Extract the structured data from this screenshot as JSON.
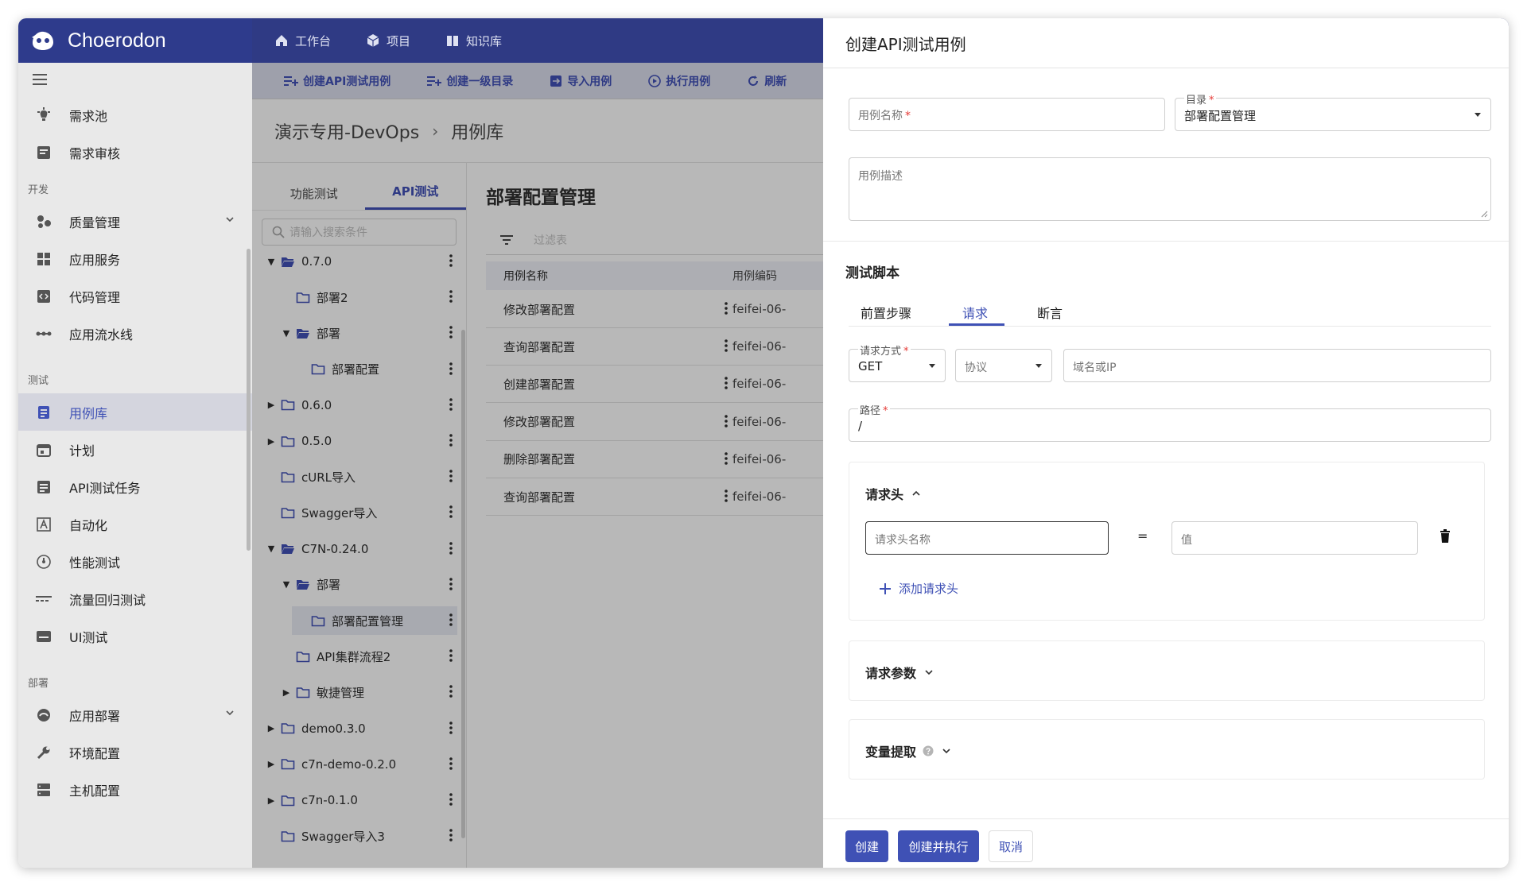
{
  "brand": {
    "name": "Choerodon"
  },
  "sidebar": {
    "items_top": [
      {
        "label": "需求池",
        "icon": "bulb-icon"
      },
      {
        "label": "需求审核",
        "icon": "review-icon"
      }
    ],
    "groups": [
      {
        "title": "开发",
        "items": [
          {
            "label": "质量管理",
            "icon": "quality-icon"
          },
          {
            "label": "应用服务",
            "icon": "app-service-icon"
          },
          {
            "label": "代码管理",
            "icon": "code-icon"
          },
          {
            "label": "应用流水线",
            "icon": "pipeline-icon"
          }
        ]
      },
      {
        "title": "测试",
        "items": [
          {
            "label": "用例库",
            "icon": "case-library-icon"
          },
          {
            "label": "计划",
            "icon": "calendar-icon"
          },
          {
            "label": "API测试任务",
            "icon": "api-task-icon"
          },
          {
            "label": "自动化",
            "icon": "automation-icon"
          },
          {
            "label": "性能测试",
            "icon": "performance-icon"
          },
          {
            "label": "流量回归测试",
            "icon": "traffic-icon"
          },
          {
            "label": "UI测试",
            "icon": "ui-test-icon"
          }
        ]
      },
      {
        "title": "部署",
        "items": [
          {
            "label": "应用部署",
            "icon": "deploy-icon"
          },
          {
            "label": "环境配置",
            "icon": "wrench-icon"
          },
          {
            "label": "主机配置",
            "icon": "server-icon"
          }
        ]
      }
    ]
  },
  "topnav": [
    {
      "label": "工作台",
      "icon": "home-icon"
    },
    {
      "label": "项目",
      "icon": "cube-icon"
    },
    {
      "label": "知识库",
      "icon": "book-icon"
    }
  ],
  "toolbar": [
    {
      "label": "创建API测试用例",
      "icon": "add-list-icon"
    },
    {
      "label": "创建一级目录",
      "icon": "add-list-icon"
    },
    {
      "label": "导入用例",
      "icon": "import-icon"
    },
    {
      "label": "执行用例",
      "icon": "play-icon"
    },
    {
      "label": "刷新",
      "icon": "refresh-icon"
    }
  ],
  "breadcrumb": {
    "project": "演示专用-DevOps",
    "sep": "›",
    "page": "用例库"
  },
  "tree": {
    "tabs": [
      "功能测试",
      "API测试"
    ],
    "search_placeholder": "请输入搜索条件",
    "nodes": [
      {
        "label": "0.7.0"
      },
      {
        "label": "部署2"
      },
      {
        "label": "部署"
      },
      {
        "label": "部署配置"
      },
      {
        "label": "0.6.0"
      },
      {
        "label": "0.5.0"
      },
      {
        "label": "cURL导入"
      },
      {
        "label": "Swagger导入"
      },
      {
        "label": "C7N-0.24.0"
      },
      {
        "label": "部署"
      },
      {
        "label": "部署配置管理"
      },
      {
        "label": "API集群流程2"
      },
      {
        "label": "敏捷管理"
      },
      {
        "label": "demo0.3.0"
      },
      {
        "label": "c7n-demo-0.2.0"
      },
      {
        "label": "c7n-0.1.0"
      },
      {
        "label": "Swagger导入3"
      }
    ]
  },
  "list": {
    "title": "部署配置管理",
    "filter_placeholder": "过滤表",
    "columns": [
      "用例名称",
      "用例编码"
    ],
    "rows": [
      {
        "name": "修改部署配置",
        "code": "feifei-06-"
      },
      {
        "name": "查询部署配置",
        "code": "feifei-06-"
      },
      {
        "name": "创建部署配置",
        "code": "feifei-06-"
      },
      {
        "name": "修改部署配置",
        "code": "feifei-06-"
      },
      {
        "name": "删除部署配置",
        "code": "feifei-06-"
      },
      {
        "name": "查询部署配置",
        "code": "feifei-06-"
      }
    ]
  },
  "drawer": {
    "title": "创建API测试用例",
    "case_name_label": "用例名称",
    "required_mark": "*",
    "catalog_label": "目录",
    "catalog_value": "部署配置管理",
    "desc_label": "用例描述",
    "script_title": "测试脚本",
    "tabs": [
      "前置步骤",
      "请求",
      "断言"
    ],
    "method_label": "请求方式",
    "method_value": "GET",
    "protocol_placeholder": "协议",
    "host_placeholder": "域名或IP",
    "path_label": "路径",
    "path_value": "/",
    "headers_title": "请求头",
    "header_name_placeholder": "请求头名称",
    "equals": "=",
    "header_value_placeholder": "值",
    "add_header_label": "添加请求头",
    "params_title": "请求参数",
    "extract_title": "变量提取",
    "buttons": {
      "create": "创建",
      "create_run": "创建并执行",
      "cancel": "取消"
    }
  },
  "colors": {
    "brand": "#2e3b8c",
    "accent": "#3f51b5",
    "required": "#e53935"
  }
}
